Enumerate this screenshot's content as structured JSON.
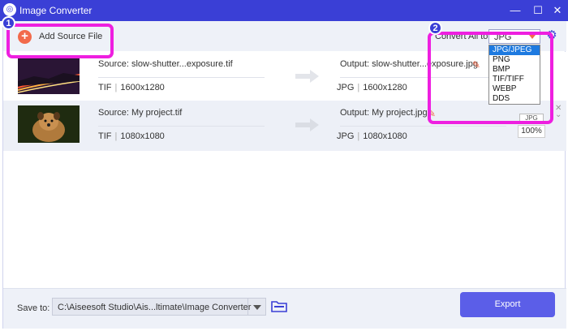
{
  "window": {
    "title": "Image Converter",
    "app_icon": "app-icon",
    "minimize": "—",
    "maximize": "☐",
    "close": "✕"
  },
  "toolbar": {
    "add_source_label": "Add Source File",
    "add_icon": "+",
    "convert_all_label": "Convert All to:",
    "format_value": "JPG",
    "format_options": [
      "JPG/JPEG",
      "PNG",
      "BMP",
      "TIF/TIFF",
      "WEBP",
      "DDS"
    ],
    "format_selected_index": 0,
    "settings_icon": "⚙"
  },
  "files": [
    {
      "source": "Source: slow-shutter...exposure.tif",
      "src_format": "TIF",
      "src_size": "1600x1280",
      "output": "Output: slow-shutter...exposure.jpg",
      "out_format": "JPG",
      "out_size": "1600x1280",
      "edit_icon": "✎"
    },
    {
      "source": "Source: My project.tif",
      "src_format": "TIF",
      "src_size": "1080x1080",
      "output": "Output: My project.jpg",
      "out_format": "JPG",
      "out_size": "1080x1080",
      "edit_icon": "✎",
      "format_chip": "JPG",
      "quality": "100%"
    }
  ],
  "bottom": {
    "save_to_label": "Save to:",
    "save_path": "C:\\Aiseesoft Studio\\Ais...ltimate\\Image Converter",
    "export_label": "Export"
  },
  "annotations": {
    "badge1": "1",
    "badge2": "2"
  },
  "colors": {
    "accent": "#3a3fd6",
    "add_icon": "#f26a4b",
    "highlight": "#ee1fe0",
    "export": "#5b5ee8",
    "selected_option": "#1e7ae0"
  }
}
